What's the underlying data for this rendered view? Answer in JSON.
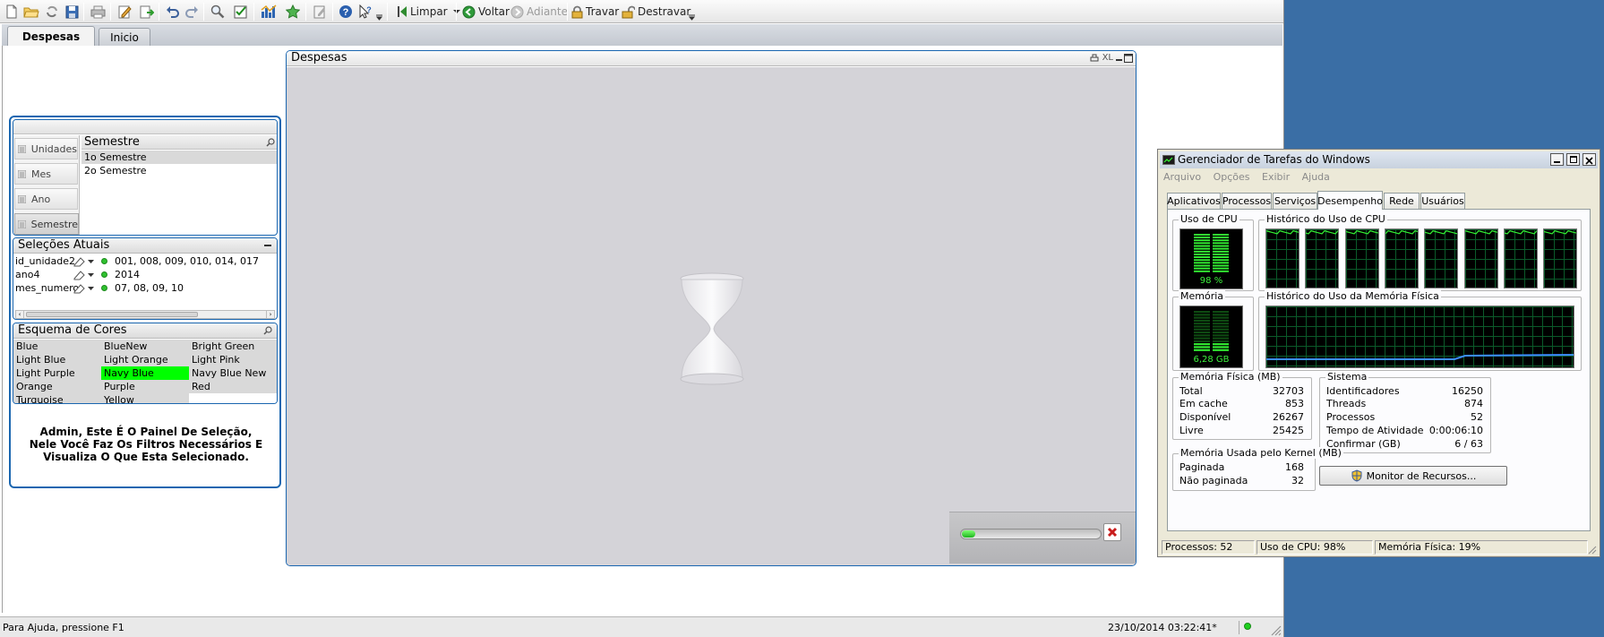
{
  "toolbar": {
    "limpar_label": "Limpar",
    "voltar_label": "Voltar",
    "adiante_label": "Adiante",
    "travar_label": "Travar",
    "destravar_label": "Destravar"
  },
  "sheet_tabs": [
    {
      "label": "Despesas",
      "active": true
    },
    {
      "label": "Inicio",
      "active": false
    }
  ],
  "despesas_chart": {
    "title": "Despesas",
    "xl_label": "XL",
    "progress": 0.1
  },
  "list_selector": {
    "tabs": [
      "Unidades",
      "Mes",
      "Ano",
      "Semestre"
    ],
    "active_tab": "Semestre",
    "list_title": "Semestre",
    "values": [
      {
        "label": "1o Semestre",
        "selected": true
      },
      {
        "label": "2o Semestre",
        "selected": false
      }
    ]
  },
  "current_selections": {
    "title": "Seleções Atuais",
    "rows": [
      {
        "field": "id_unidade2",
        "value": "001, 008, 009, 010, 014, 017"
      },
      {
        "field": "ano4",
        "value": "2014"
      },
      {
        "field": "mes_numero",
        "value": "07, 08, 09, 10"
      }
    ]
  },
  "color_scheme": {
    "title": "Esquema de Cores",
    "items": [
      [
        "Blue",
        "BlueNew",
        "Bright Green"
      ],
      [
        "Light Blue",
        "Light Orange",
        "Light Pink"
      ],
      [
        "Light Purple",
        "Navy Blue",
        "Navy Blue New"
      ],
      [
        "Orange",
        "Purple",
        "Red"
      ],
      [
        "Turquoise",
        "Yellow",
        ""
      ]
    ],
    "selected": "Navy Blue",
    "selected_color": "#00ff00"
  },
  "help_text": "Admin, Este É O Painel De Seleção, Nele Você Faz Os Filtros Necessários E Visualiza O Que Esta Selecionado.",
  "status": {
    "help": "Para Ajuda, pressione F1",
    "datetime": "23/10/2014 03:22:41*"
  },
  "task_manager": {
    "title": "Gerenciador de Tarefas do Windows",
    "menu": [
      "Arquivo",
      "Opções",
      "Exibir",
      "Ajuda"
    ],
    "tabs": [
      "Aplicativos",
      "Processos",
      "Serviços",
      "Desempenho",
      "Rede",
      "Usuários"
    ],
    "active_tab": "Desempenho",
    "cpu_label": "Uso de CPU",
    "cpu_value": "98 %",
    "cpu_fraction": 0.98,
    "cpu_history_label": "Histórico do Uso de CPU",
    "mem_label": "Memória",
    "mem_value": "6,28 GB",
    "mem_fraction": 0.19,
    "mem_history_label": "Histórico do Uso da Memória Física",
    "physical": {
      "title": "Memória Física (MB)",
      "rows": [
        {
          "k": "Total",
          "v": "32703"
        },
        {
          "k": "Em cache",
          "v": "853"
        },
        {
          "k": "Disponível",
          "v": "26267"
        },
        {
          "k": "Livre",
          "v": "25425"
        }
      ]
    },
    "system": {
      "title": "Sistema",
      "rows": [
        {
          "k": "Identificadores",
          "v": "16250"
        },
        {
          "k": "Threads",
          "v": "874"
        },
        {
          "k": "Processos",
          "v": "52"
        },
        {
          "k": "Tempo de Atividade",
          "v": "0:00:06:10"
        },
        {
          "k": "Confirmar (GB)",
          "v": "6 / 63"
        }
      ]
    },
    "kernel": {
      "title": "Memória Usada pelo Kernel (MB)",
      "rows": [
        {
          "k": "Paginada",
          "v": "168"
        },
        {
          "k": "Não paginada",
          "v": "32"
        }
      ]
    },
    "resource_monitor_label": "Monitor de Recursos...",
    "status": {
      "processes": "Processos: 52",
      "cpu": "Uso de CPU: 98%",
      "memory": "Memória Física: 19%"
    }
  }
}
